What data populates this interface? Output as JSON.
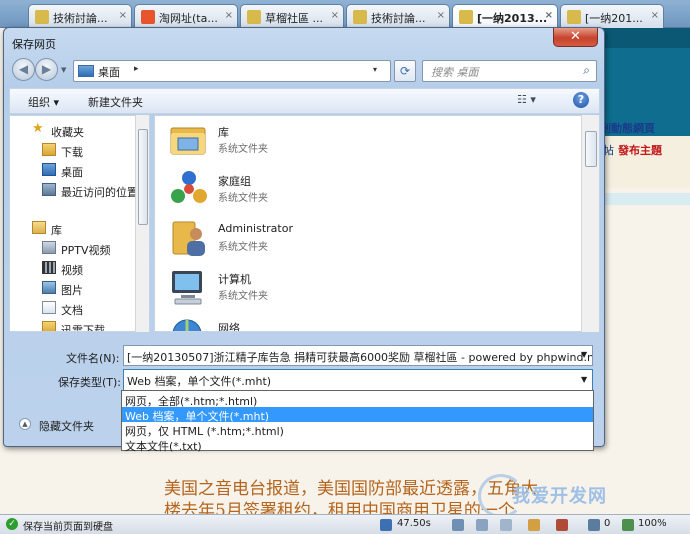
{
  "browser": {
    "tabs": [
      {
        "label": "技術討論...",
        "fav_color": "#d8b94c"
      },
      {
        "label": "淘网址(ta...",
        "fav_color": "#e8542b"
      },
      {
        "label": "草榴社區 ...",
        "fav_color": "#d8b94c"
      },
      {
        "label": "技術討論...",
        "fav_color": "#d8b94c"
      },
      {
        "label": "[一纳2013...",
        "fav_color": "#d8b94c"
      },
      {
        "label": "[一纳201...",
        "fav_color": "#d8b94c"
      }
    ],
    "tab_close": "×",
    "page": {
      "title_link": "剎動態網頁",
      "post_link": "帖",
      "new_topic_link": "發布主題",
      "article_line1": "美国之音电台报道，美国国防部最近透露，五角大",
      "article_line2": "楼去年5月签署租约，租用中国商用卫星的一个",
      "watermark": "我爱开发网"
    },
    "status": {
      "text": "保存当前页面到硬盘",
      "speed": "47.50s",
      "count": "0",
      "zoom": "100%"
    }
  },
  "dialog": {
    "title": "保存网页",
    "close_label": "✕",
    "address": {
      "location": "桌面",
      "separator": "▸",
      "dropdown": "▾"
    },
    "search_placeholder": "搜索 桌面",
    "toolbar": {
      "organize": "组织 ▾",
      "new_folder": "新建文件夹",
      "view": "☷ ▾",
      "help": "?"
    },
    "nav": [
      {
        "label": "收藏夹",
        "icon": "star-icon",
        "indent": false
      },
      {
        "label": "下载",
        "icon": "download-folder-icon",
        "indent": true
      },
      {
        "label": "桌面",
        "icon": "desktop-icon",
        "indent": true
      },
      {
        "label": "最近访问的位置",
        "icon": "recent-places-icon",
        "indent": true
      },
      {
        "label": "库",
        "icon": "library-icon",
        "indent": false
      },
      {
        "label": "PPTV视频",
        "icon": "video-library-icon",
        "indent": true
      },
      {
        "label": "视频",
        "icon": "video-icon",
        "indent": true
      },
      {
        "label": "图片",
        "icon": "pictures-icon",
        "indent": true
      },
      {
        "label": "文档",
        "icon": "documents-icon",
        "indent": true
      },
      {
        "label": "迅雷下载",
        "icon": "thunder-download-icon",
        "indent": true
      }
    ],
    "files": [
      {
        "name": "库",
        "type": "系统文件夹",
        "icon": "library-folder-icon"
      },
      {
        "name": "家庭组",
        "type": "系统文件夹",
        "icon": "homegroup-icon"
      },
      {
        "name": "Administrator",
        "type": "系统文件夹",
        "icon": "user-folder-icon"
      },
      {
        "name": "计算机",
        "type": "系统文件夹",
        "icon": "computer-icon"
      },
      {
        "name": "网络",
        "type": "",
        "icon": "network-icon"
      }
    ],
    "form": {
      "filename_label": "文件名(N):",
      "filename_value": "[一纳20130507]浙江精子库告急 捐精可获最高6000奖励 草榴社區 - powered by phpwind.net",
      "filetype_label": "保存类型(T):",
      "filetype_value": "Web 档案，单个文件(*.mht)",
      "filetype_options": [
        "网页，全部(*.htm;*.html)",
        "Web 档案，单个文件(*.mht)",
        "网页，仅 HTML (*.htm;*.html)",
        "文本文件(*.txt)"
      ],
      "selected_index": 1
    },
    "hide_folders": "隐藏文件夹"
  }
}
